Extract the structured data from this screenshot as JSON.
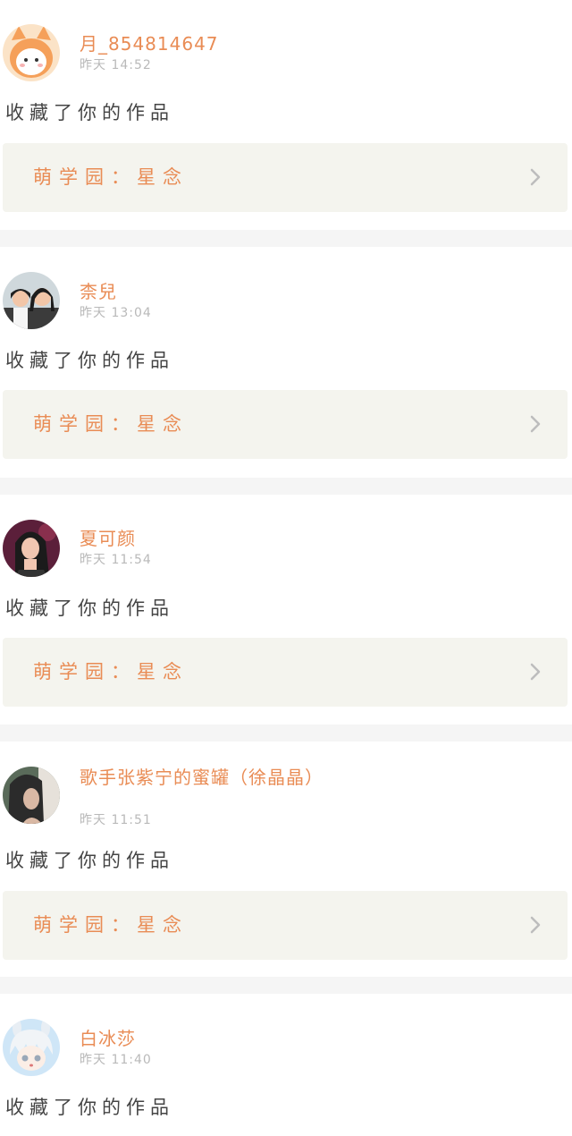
{
  "feed": {
    "items": [
      {
        "name": "月_854814647",
        "time": "昨天 14:52",
        "action": "收藏了你的作品",
        "work_title": "萌学园：星念",
        "avatar": "fox-hood-avatar-icon",
        "avatar_colors": [
          "#fbe3c7",
          "#f5a05a",
          "#fff"
        ]
      },
      {
        "name": "柰兒",
        "time": "昨天 13:04",
        "action": "收藏了你的作品",
        "work_title": "萌学园：星念",
        "avatar": "two-girls-photo-avatar",
        "avatar_colors": [
          "#cfd8dc",
          "#2c2c2c",
          "#f2c6a8"
        ]
      },
      {
        "name": "夏可颜",
        "time": "昨天 11:54",
        "action": "收藏了你的作品",
        "work_title": "萌学园：星念",
        "avatar": "girl-photo-avatar",
        "avatar_colors": [
          "#5b1f3a",
          "#1b1b1b",
          "#f1c6b1"
        ]
      },
      {
        "name": "歌手张紫宁的蜜罐（徐晶晶）",
        "time": "昨天 11:51",
        "action": "收藏了你的作品",
        "work_title": "萌学园：星念",
        "avatar": "woman-photo-avatar",
        "avatar_colors": [
          "#5a6b5a",
          "#2b2b2b",
          "#d9b8a4"
        ]
      },
      {
        "name": "白冰莎",
        "time": "昨天 11:40",
        "action": "收藏了你的作品",
        "work_title": "",
        "avatar": "anime-boy-avatar",
        "avatar_colors": [
          "#cfe6f7",
          "#e8eef4",
          "#9aa8b8"
        ]
      }
    ]
  },
  "colors": {
    "accent": "#e98c55",
    "card_bg": "#f4f4ee",
    "divider": "#f5f5f5",
    "time": "#b9b9b9",
    "text": "#444444"
  }
}
